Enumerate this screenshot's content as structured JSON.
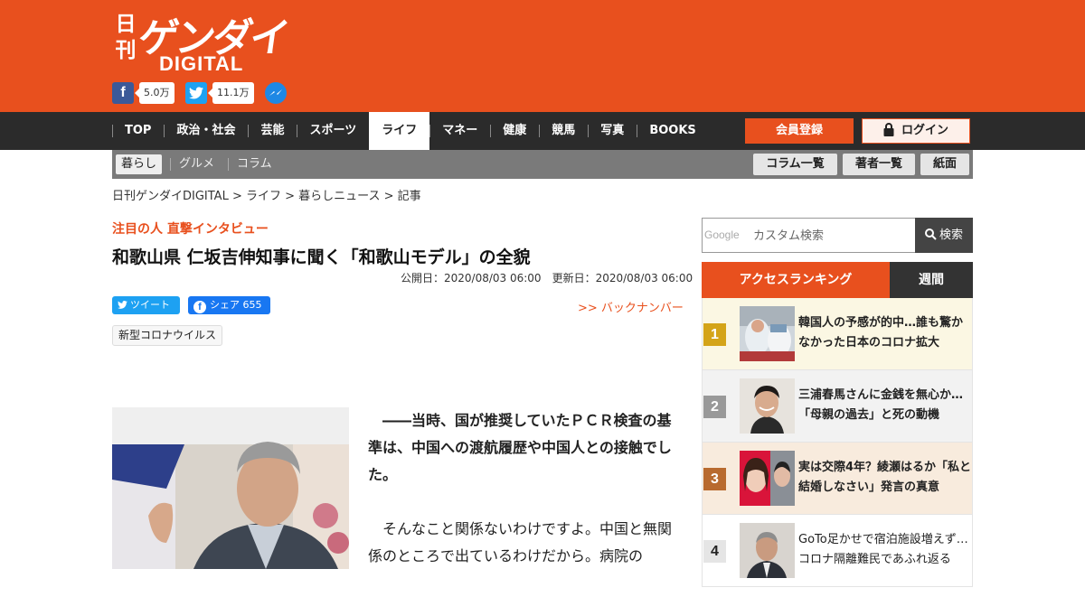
{
  "brand": {
    "logo_kanji": "日刊",
    "logo_katakana": "ゲンダイ",
    "logo_latin": "DIGITAL",
    "color": "#e8501e"
  },
  "social": {
    "facebook_count": "5.0万",
    "twitter_count": "11.1万",
    "icons": [
      "facebook-icon",
      "twitter-icon",
      "messenger-icon"
    ]
  },
  "nav": {
    "items": [
      "TOP",
      "政治・社会",
      "芸能",
      "スポーツ",
      "ライフ",
      "マネー",
      "健康",
      "競馬",
      "写真",
      "BOOKS"
    ],
    "active": "ライフ",
    "register_label": "会員登録",
    "login_label": "ログイン"
  },
  "subnav": {
    "items": [
      "暮らし",
      "グルメ",
      "コラム"
    ],
    "active": "暮らし",
    "buttons": [
      "コラム一覧",
      "著者一覧",
      "紙面"
    ]
  },
  "breadcrumb": "日刊ゲンダイDIGITAL > ライフ > 暮らしニュース > 記事",
  "article": {
    "kicker": "注目の人 直撃インタビュー",
    "title": "和歌山県 仁坂吉伸知事に聞く「和歌山モデル」の全貌",
    "published": "公開日：2020/08/03 06:00",
    "updated": "更新日：2020/08/03 06:00",
    "tweet_label": "ツイート",
    "share_label": "シェア",
    "share_count": "655",
    "back_number": ">> バックナンバー",
    "tag": "新型コロナウイルス",
    "paragraphs": [
      "――当時、国が推奨していたＰＣＲ検査の基準は、中国への渡航履歴や中国人との接触でした。",
      "そんなこと関係ないわけですよ。中国と無関係のところで出ているわけだから。病院の"
    ]
  },
  "search": {
    "brand": "Google",
    "placeholder": "カスタム検索",
    "button_label": "検索"
  },
  "ranking": {
    "tab_access": "アクセスランキング",
    "tab_weekly": "週間",
    "items": [
      {
        "rank": "1",
        "title": "韓国人の予感が的中…誰も驚かなかった日本のコロナ拡大",
        "bg": "#fbf7e3",
        "badge": "#d4a419"
      },
      {
        "rank": "2",
        "title": "三浦春馬さんに金銭を無心か…「母親の過去」と死の動機",
        "bg": "#f2f2f2",
        "badge": "#999999"
      },
      {
        "rank": "3",
        "title": "実は交際4年？綾瀬はるか「私と結婚しなさい」発言の真意",
        "bg": "#f8ebdd",
        "badge": "#b86a2f"
      },
      {
        "rank": "4",
        "title": "GoTo足かせで宿泊施設増えず…コロナ隔離難民であふれ返る",
        "bg": "#ffffff",
        "badge": "#e5e5e5"
      }
    ]
  }
}
